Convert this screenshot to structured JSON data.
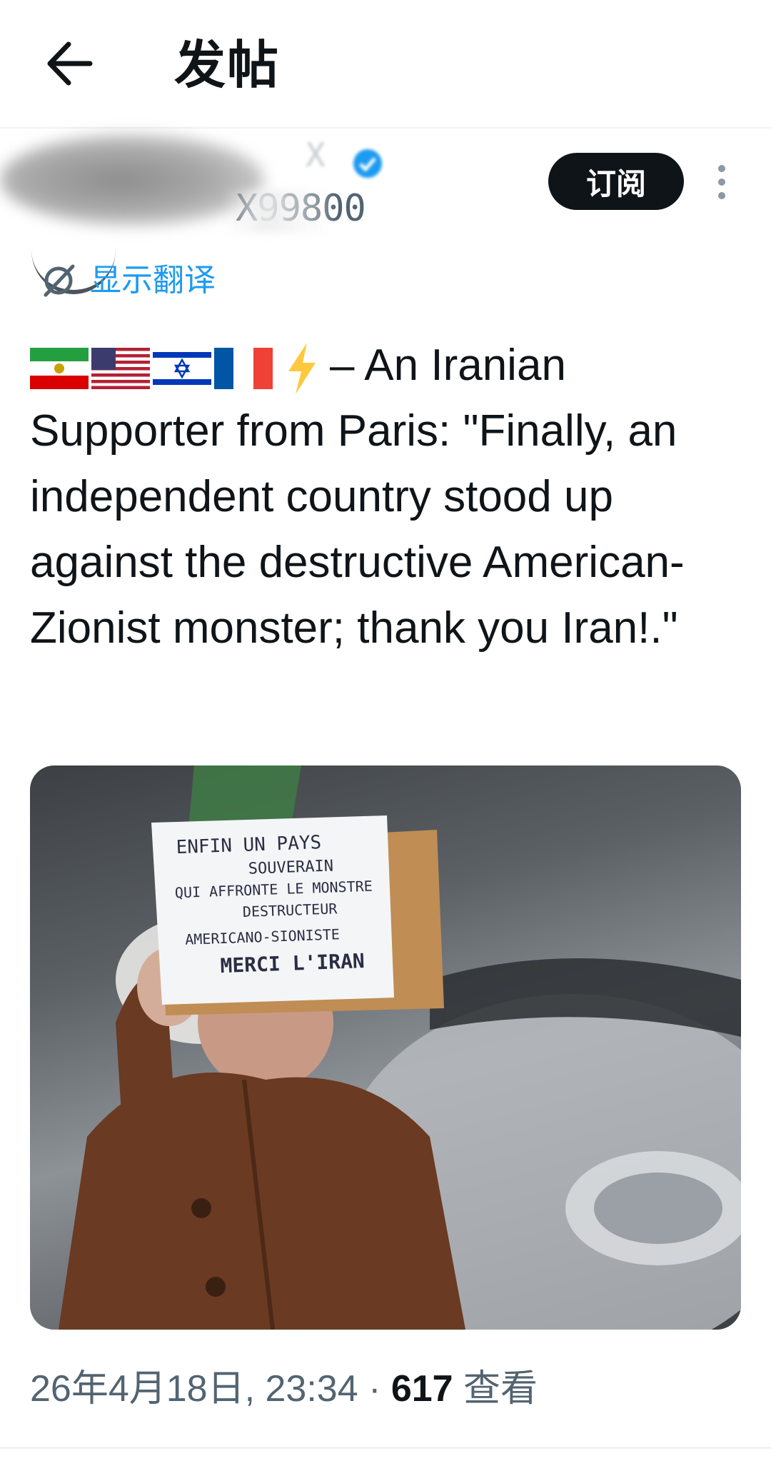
{
  "header": {
    "title": "发帖"
  },
  "author": {
    "name_fragment": "X",
    "handle": "X99800",
    "subscribe_label": "订阅"
  },
  "translate": {
    "label": "显示翻译"
  },
  "tweet": {
    "text": "– An Iranian Supporter from Paris: \"Finally, an independent country stood up against the destructive American-Zionist monster; thank you Iran!.\""
  },
  "media": {
    "sign": {
      "line1": "ENFIN UN PAYS",
      "line2": "SOUVERAIN",
      "line3": "QUI AFFRONTE LE MONSTRE",
      "line4": "DESTRUCTEUR",
      "line5": "AMERICANO-SIONISTE",
      "line6": "MERCI L'IRAN"
    }
  },
  "meta": {
    "timestamp": "26年4月18日, 23:34 · ",
    "views_count": "617",
    "views_label": " 查看"
  },
  "colors": {
    "accent": "#1d9bf0",
    "text": "#0f1419",
    "secondary": "#536471",
    "button_bg": "#0f1419"
  },
  "icons": [
    "back-arrow-icon",
    "verified-icon",
    "more-icon",
    "translate-icon",
    "flag-iran-icon",
    "flag-us-icon",
    "flag-israel-icon",
    "flag-france-icon",
    "lightning-icon"
  ]
}
